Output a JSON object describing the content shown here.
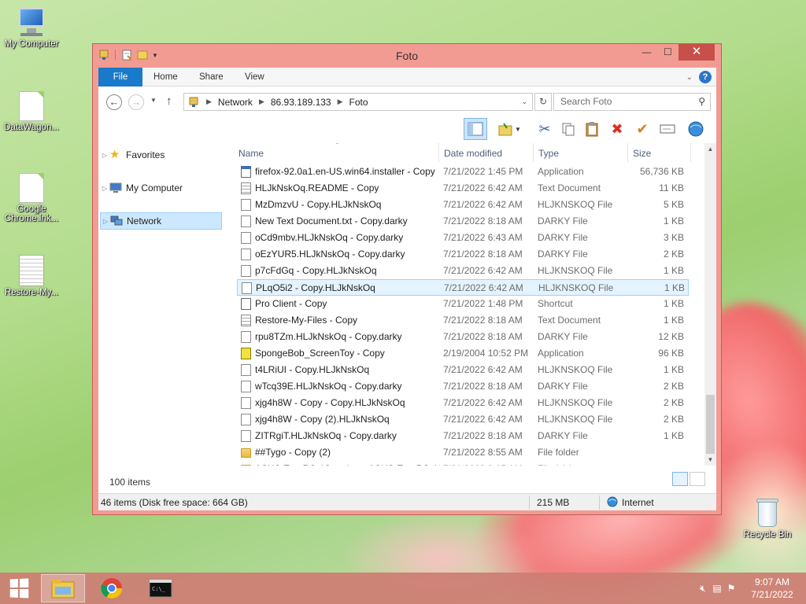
{
  "desktop": {
    "icons": [
      {
        "label": "My Computer",
        "icon": "computer-icon"
      },
      {
        "label": "DataWagon...",
        "icon": "document-icon"
      },
      {
        "label": "Google Chrome.lnk...",
        "icon": "document-icon"
      },
      {
        "label": "Restore-My...",
        "icon": "text-document-icon"
      },
      {
        "label": "Recycle Bin",
        "icon": "recycle-bin-icon"
      }
    ]
  },
  "window": {
    "title": "Foto",
    "minimize": "—",
    "maximize": "☐",
    "close": "✕",
    "ribbon_tabs": [
      "File",
      "Home",
      "Share",
      "View"
    ],
    "address": {
      "back": "←",
      "forward": "→",
      "up": "↑",
      "crumbs": [
        "Network",
        "86.93.189.133",
        "Foto"
      ]
    },
    "search_placeholder": "Search Foto",
    "nav": {
      "favorites": "Favorites",
      "my_computer": "My Computer",
      "network": "Network"
    },
    "columns": {
      "name": "Name",
      "date": "Date modified",
      "type": "Type",
      "size": "Size"
    },
    "files": [
      {
        "name": "firefox-92.0a1.en-US.win64.installer - Copy",
        "date": "7/21/2022 1:45 PM",
        "type": "Application",
        "size": "56,736 KB",
        "icon": "app"
      },
      {
        "name": "HLJkNskOq.README - Copy",
        "date": "7/21/2022 6:42 AM",
        "type": "Text Document",
        "size": "11 KB",
        "icon": "txt"
      },
      {
        "name": "MzDmzvU - Copy.HLJkNskOq",
        "date": "7/21/2022 6:42 AM",
        "type": "HLJKNSKOQ File",
        "size": "5 KB",
        "icon": "doc"
      },
      {
        "name": "New Text Document.txt - Copy.darky",
        "date": "7/21/2022 8:18 AM",
        "type": "DARKY File",
        "size": "1 KB",
        "icon": "doc"
      },
      {
        "name": "oCd9mbv.HLJkNskOq - Copy.darky",
        "date": "7/21/2022 6:43 AM",
        "type": "DARKY File",
        "size": "3 KB",
        "icon": "doc"
      },
      {
        "name": "oEzYUR5.HLJkNskOq - Copy.darky",
        "date": "7/21/2022 8:18 AM",
        "type": "DARKY File",
        "size": "2 KB",
        "icon": "doc"
      },
      {
        "name": "p7cFdGq - Copy.HLJkNskOq",
        "date": "7/21/2022 6:42 AM",
        "type": "HLJKNSKOQ File",
        "size": "1 KB",
        "icon": "doc"
      },
      {
        "name": "PLqO5i2 - Copy.HLJkNskOq",
        "date": "7/21/2022 6:42 AM",
        "type": "HLJKNSKOQ File",
        "size": "1 KB",
        "icon": "doc",
        "selected": true
      },
      {
        "name": "Pro Client - Copy",
        "date": "7/21/2022 1:48 PM",
        "type": "Shortcut",
        "size": "1 KB",
        "icon": "short"
      },
      {
        "name": "Restore-My-Files - Copy",
        "date": "7/21/2022 8:18 AM",
        "type": "Text Document",
        "size": "1 KB",
        "icon": "txt"
      },
      {
        "name": "rpu8TZm.HLJkNskOq - Copy.darky",
        "date": "7/21/2022 8:18 AM",
        "type": "DARKY File",
        "size": "12 KB",
        "icon": "doc"
      },
      {
        "name": "SpongeBob_ScreenToy - Copy",
        "date": "2/19/2004 10:52 PM",
        "type": "Application",
        "size": "96 KB",
        "icon": "sponge"
      },
      {
        "name": "t4LRiUI - Copy.HLJkNskOq",
        "date": "7/21/2022 6:42 AM",
        "type": "HLJKNSKOQ File",
        "size": "1 KB",
        "icon": "doc"
      },
      {
        "name": "wTcq39E.HLJkNskOq - Copy.darky",
        "date": "7/21/2022 8:18 AM",
        "type": "DARKY File",
        "size": "2 KB",
        "icon": "doc"
      },
      {
        "name": "xjg4h8W - Copy - Copy.HLJkNskOq",
        "date": "7/21/2022 6:42 AM",
        "type": "HLJKNSKOQ File",
        "size": "2 KB",
        "icon": "doc"
      },
      {
        "name": "xjg4h8W - Copy (2).HLJkNskOq",
        "date": "7/21/2022 6:42 AM",
        "type": "HLJKNSKOQ File",
        "size": "2 KB",
        "icon": "doc"
      },
      {
        "name": "ZITRgiT.HLJkNskOq - Copy.darky",
        "date": "7/21/2022 8:18 AM",
        "type": "DARKY File",
        "size": "1 KB",
        "icon": "doc"
      },
      {
        "name": "##Tygo - Copy (2)",
        "date": "7/21/2022 8:55 AM",
        "type": "File folder",
        "size": "",
        "icon": "folder"
      },
      {
        "name": "ASUS Eee PC 4G review_ ASUS Eee PC 4G ...",
        "date": "7/21/2022 9:05 AM",
        "type": "File folder",
        "size": "",
        "icon": "folder"
      }
    ],
    "item_count": "100 items",
    "status": {
      "left": "46 items (Disk free space: 664 GB)",
      "size": "215 MB",
      "zone": "Internet"
    }
  },
  "taskbar": {
    "time": "9:07 AM",
    "date": "7/21/2022"
  },
  "colors": {
    "window_frame": "#f29b93",
    "file_tab": "#1979ca",
    "close_button": "#c7504a",
    "selection": "#e5f3ff"
  }
}
